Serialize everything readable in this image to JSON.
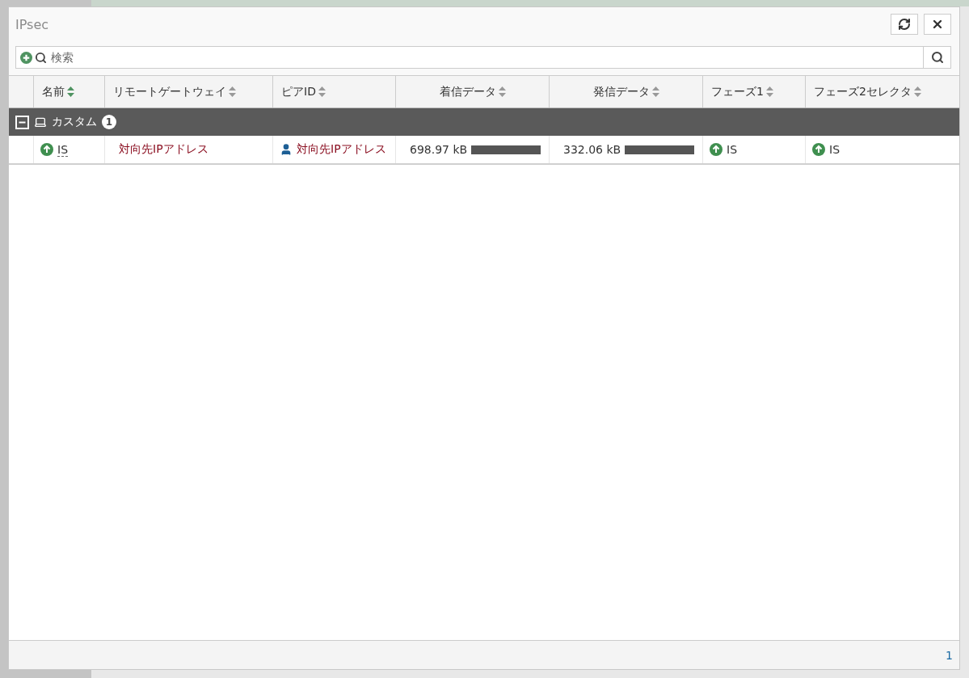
{
  "dialog": {
    "title": "IPsec",
    "search": {
      "placeholder": "検索"
    },
    "table": {
      "columns": [
        {
          "label": "名前",
          "sorted": true
        },
        {
          "label": "リモートゲートウェイ",
          "sorted": false
        },
        {
          "label": "ピアID",
          "sorted": false
        },
        {
          "label": "着信データ",
          "sorted": false
        },
        {
          "label": "発信データ",
          "sorted": false
        },
        {
          "label": "フェーズ1",
          "sorted": false
        },
        {
          "label": "フェーズ2セレクタ",
          "sorted": false
        }
      ],
      "groups": [
        {
          "label": "カスタム",
          "count": "1",
          "expanded": true,
          "rows": [
            {
              "name": {
                "text": "IS",
                "up": true
              },
              "remote_gateway": "対向先IPアドレス",
              "peer_id": "対向先IPアドレス",
              "incoming": {
                "text": "698.97 kB"
              },
              "outgoing": {
                "text": "332.06 kB"
              },
              "phase1": {
                "text": "IS",
                "up": true
              },
              "phase2_selectors": {
                "text": "IS",
                "up": true
              }
            }
          ]
        }
      ]
    },
    "footer": {
      "count": "1"
    }
  }
}
